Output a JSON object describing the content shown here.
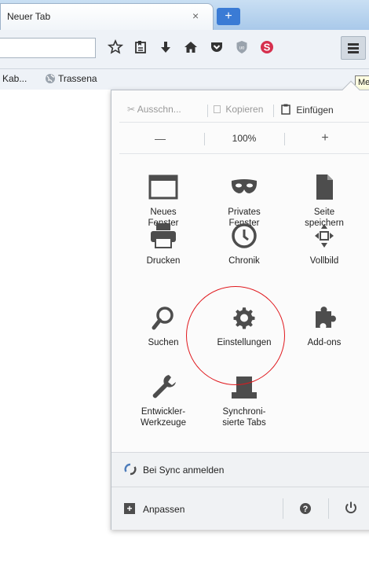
{
  "tab": {
    "title": "Neuer Tab",
    "close": "×",
    "new_tab": "+"
  },
  "bookmarks": [
    {
      "label": "Kab..."
    },
    {
      "label": "Trassena"
    }
  ],
  "tooltip": "Me",
  "edit": {
    "cut": "Ausschn...",
    "copy": "Kopieren",
    "paste": "Einfügen"
  },
  "zoom": {
    "minus": "—",
    "level": "100%",
    "plus": "+"
  },
  "grid": [
    {
      "label_1": "Neues",
      "label_2": "Fenster",
      "icon": "window-icon"
    },
    {
      "label_1": "Privates",
      "label_2": "Fenster",
      "icon": "mask-icon"
    },
    {
      "label_1": "Seite",
      "label_2": "speichern",
      "icon": "page-icon"
    },
    {
      "label_1": "Drucken",
      "icon": "printer-icon"
    },
    {
      "label_1": "Chronik",
      "icon": "clock-icon"
    },
    {
      "label_1": "Vollbild",
      "icon": "fullscreen-icon"
    },
    {
      "label_1": "Suchen",
      "icon": "search-icon"
    },
    {
      "label_1": "Einstellungen",
      "icon": "gear-icon"
    },
    {
      "label_1": "Add-ons",
      "icon": "puzzle-icon"
    },
    {
      "label_1": "Entwickler-",
      "label_2": "Werkzeuge",
      "icon": "wrench-icon"
    },
    {
      "label_1": "Synchroni-",
      "label_2": "sierte Tabs",
      "icon": "synced-tabs-icon"
    }
  ],
  "footer": {
    "sync": "Bei Sync anmelden",
    "customize": "Anpassen"
  },
  "colors": {
    "highlight_circle": "#e0191e",
    "accent": "#3a7bd5",
    "pocket": "#d6304e"
  }
}
